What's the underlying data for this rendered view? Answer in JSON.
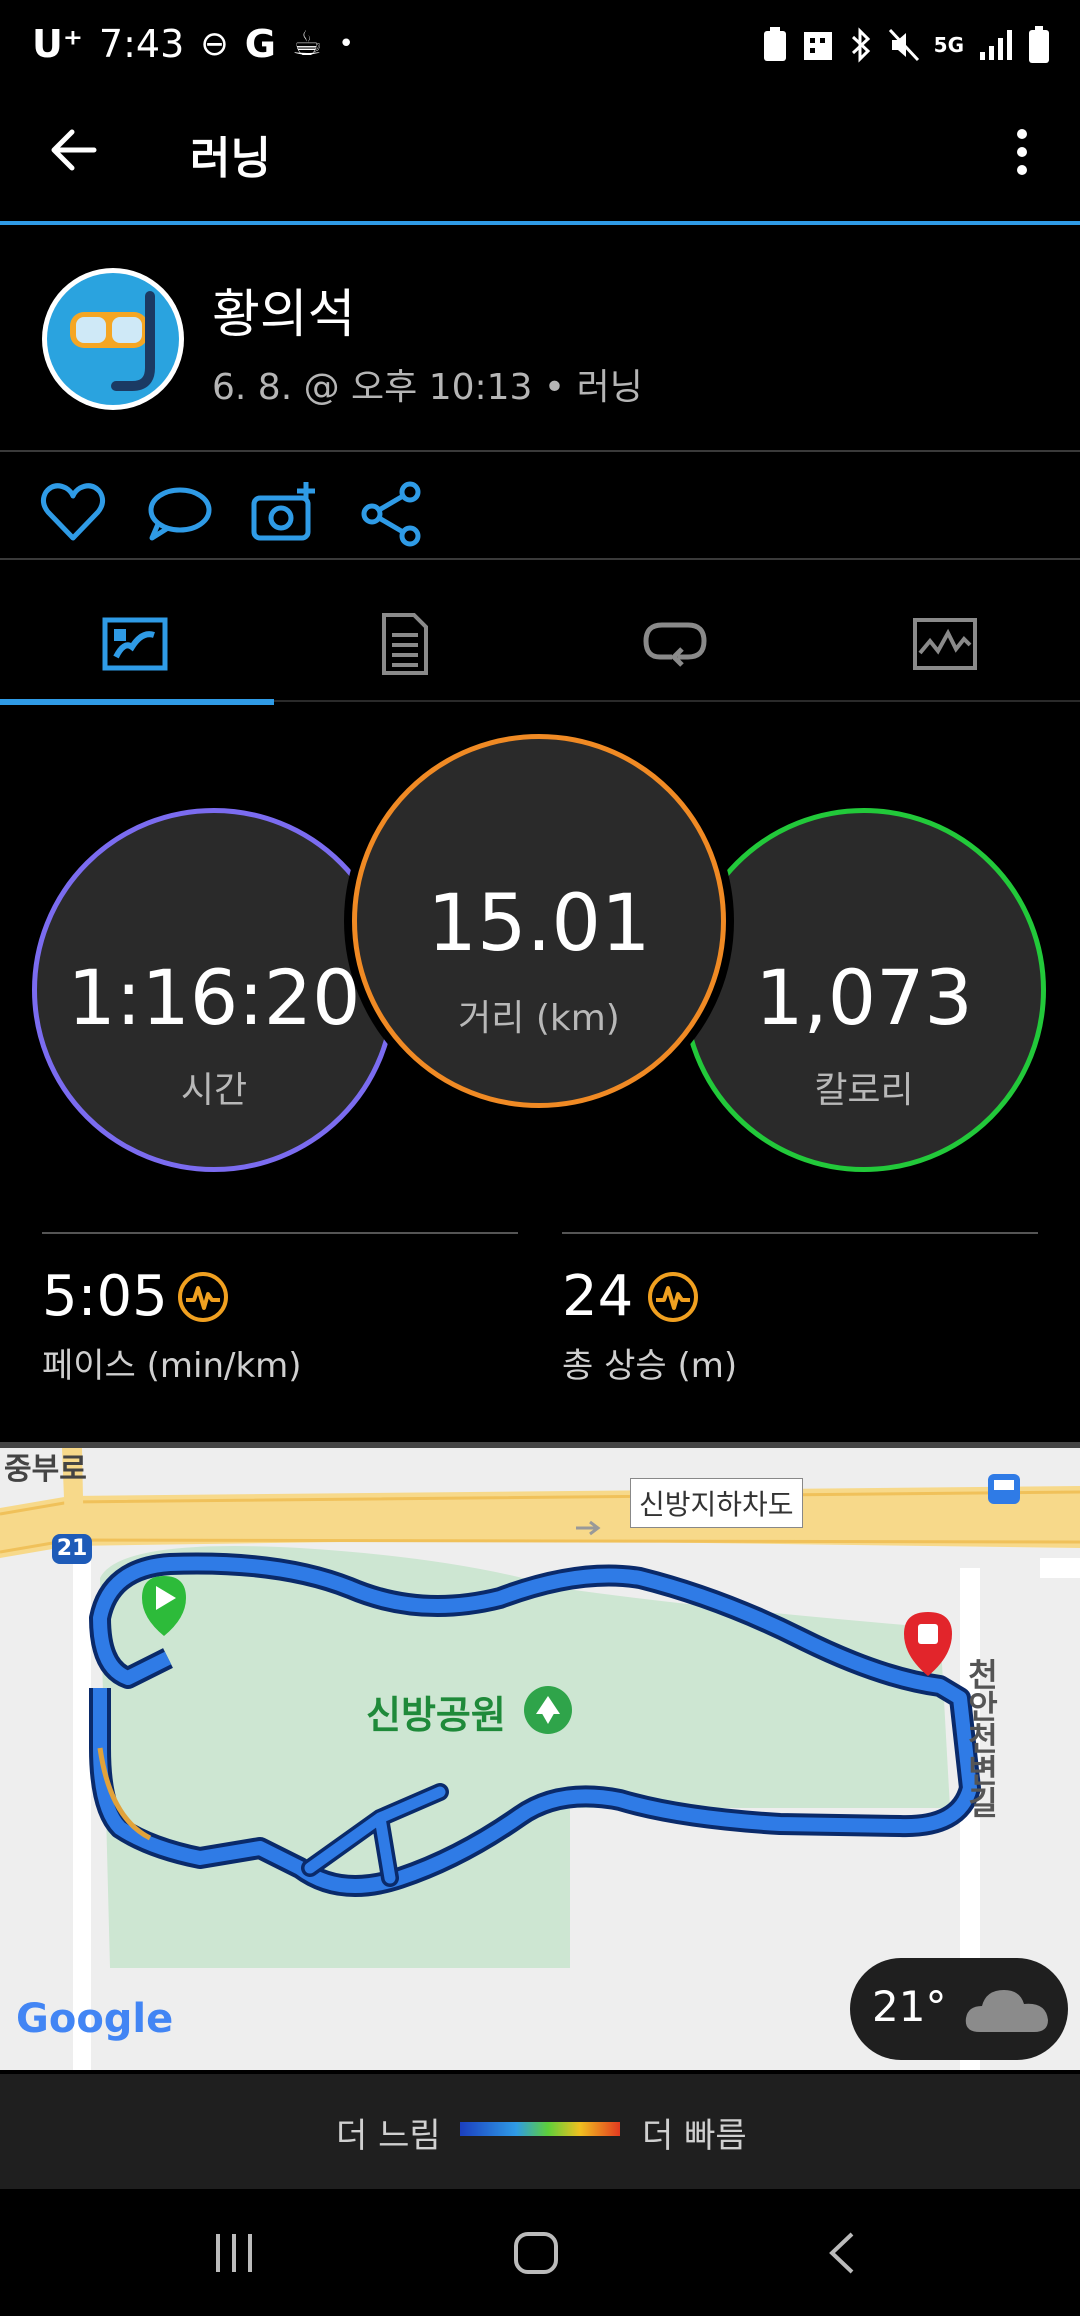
{
  "status_bar": {
    "carrier": "U⁺",
    "time": "7:43",
    "network": "5G"
  },
  "app_bar": {
    "title": "러닝"
  },
  "user": {
    "name": "황의석",
    "meta": "6. 8. @ 오후 10:13 • 러닝"
  },
  "stats": {
    "time": {
      "value": "1:16:20",
      "label": "시간"
    },
    "distance": {
      "value": "15.01",
      "label": "거리 (km)"
    },
    "calories": {
      "value": "1,073",
      "label": "칼로리"
    },
    "pace": {
      "value": "5:05",
      "label": "페이스 (min/km)"
    },
    "elevation": {
      "value": "24",
      "label": "총 상승 (m)"
    }
  },
  "map": {
    "road_label_top_left": "중부로",
    "underpass_label": "신방지하차도",
    "route_number": "21",
    "park_label": "신방공원",
    "street_label": "천안천변길",
    "google_logo": "Google",
    "weather_temp": "21°"
  },
  "legend": {
    "slower": "더 느림",
    "faster": "더 빠름"
  },
  "colors": {
    "accent_blue": "#2f9be6",
    "time_ring": "#7b6cf0",
    "distance_ring": "#f08a24",
    "calorie_ring": "#22c93a",
    "route_blue": "#1b5fd0"
  }
}
